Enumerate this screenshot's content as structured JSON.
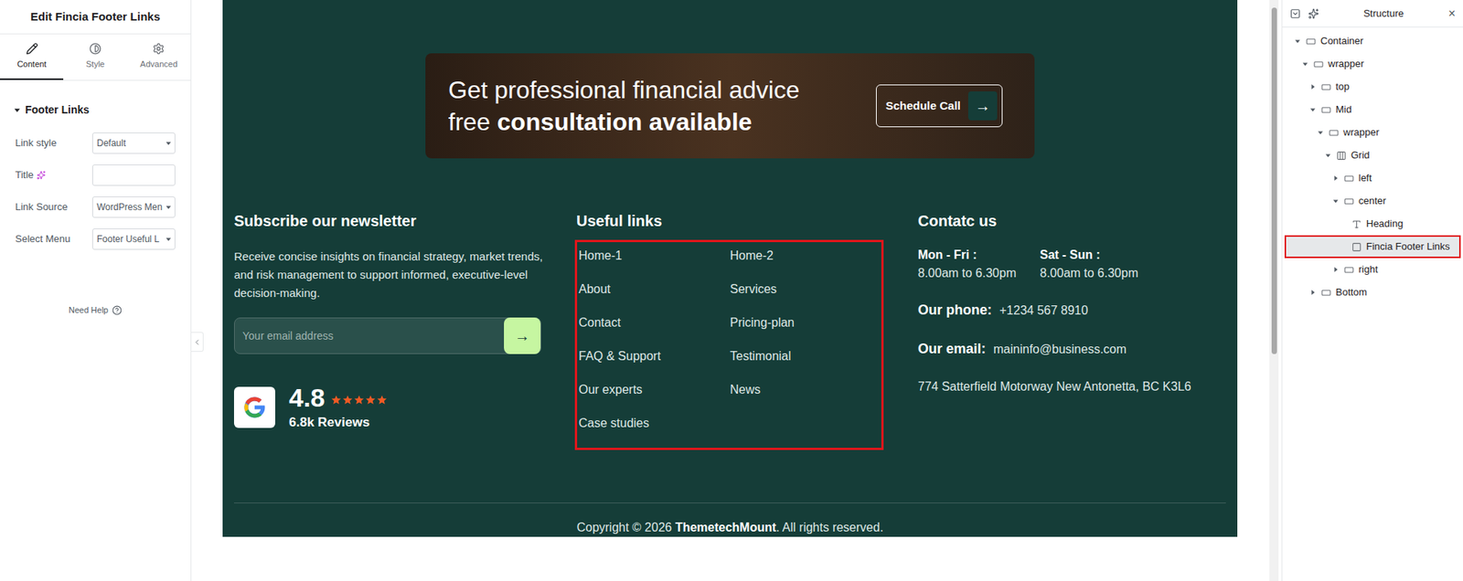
{
  "editor_panel": {
    "title": "Edit Fincia Footer Links",
    "tabs": [
      {
        "label": "Content",
        "icon": "pencil",
        "selected": true
      },
      {
        "label": "Style",
        "icon": "contrast",
        "selected": false
      },
      {
        "label": "Advanced",
        "icon": "gear",
        "selected": false
      }
    ],
    "section": {
      "title": "Footer Links",
      "expanded": true
    },
    "controls": [
      {
        "label": "Link style",
        "kind": "select",
        "value": "Default",
        "ai": false
      },
      {
        "label": "Title",
        "kind": "text",
        "value": "",
        "ai": true
      },
      {
        "label": "Link Source",
        "kind": "select",
        "value": "WordPress Men",
        "ai": false
      },
      {
        "label": "Select Menu",
        "kind": "select",
        "value": "Footer Useful L",
        "ai": false
      }
    ],
    "help": "Need Help"
  },
  "cta": {
    "line1": "Get professional financial advice",
    "line2_regular": "free ",
    "line2_bold": "consultation available",
    "button": "Schedule Call",
    "button_icon": "→"
  },
  "newsletter": {
    "heading": "Subscribe our newsletter",
    "text": "Receive concise insights on financial strategy, market trends, and risk management to support informed, executive-level decision-making.",
    "placeholder": "Your email address",
    "submit_icon": "→"
  },
  "rating": {
    "score": "4.8",
    "stars": 5,
    "reviews": "6.8k Reviews"
  },
  "useful_links": {
    "heading": "Useful links",
    "selected": true,
    "links": [
      "Home-1",
      "Home-2",
      "About",
      "Services",
      "Contact",
      "Pricing-plan",
      "FAQ & Support",
      "Testimonial",
      "Our experts",
      "News",
      "Case studies"
    ]
  },
  "contact": {
    "heading": "Contatc us",
    "hours": [
      {
        "day": "Mon - Fri :",
        "time": "8.00am to 6.30pm"
      },
      {
        "day": "Sat - Sun :",
        "time": "8.00am to 6.30pm"
      }
    ],
    "phone_label": "Our phone:",
    "phone": "+1234 567 8910",
    "email_label": "Our email:",
    "email": "maininfo@business.com",
    "address": "774 Satterfield Motorway New Antonetta, BC K3L6"
  },
  "copyright": {
    "prefix": "Copyright © 2026 ",
    "brand": "ThemetechMount",
    "suffix": ". All rights reserved."
  },
  "structure": {
    "title": "Structure",
    "close": "×",
    "items": [
      {
        "label": "Container",
        "depth": 0,
        "kind": "container",
        "expandable": true,
        "expanded": true,
        "selected": false
      },
      {
        "label": "wrapper",
        "depth": 1,
        "kind": "container",
        "expandable": true,
        "expanded": true,
        "selected": false
      },
      {
        "label": "top",
        "depth": 2,
        "kind": "container",
        "expandable": true,
        "expanded": false,
        "selected": false
      },
      {
        "label": "Mid",
        "depth": 2,
        "kind": "container",
        "expandable": true,
        "expanded": true,
        "selected": false
      },
      {
        "label": "wrapper",
        "depth": 3,
        "kind": "container",
        "expandable": true,
        "expanded": true,
        "selected": false
      },
      {
        "label": "Grid",
        "depth": 4,
        "kind": "grid",
        "expandable": true,
        "expanded": true,
        "selected": false
      },
      {
        "label": "left",
        "depth": 5,
        "kind": "container",
        "expandable": true,
        "expanded": false,
        "selected": false
      },
      {
        "label": "center",
        "depth": 5,
        "kind": "container",
        "expandable": true,
        "expanded": true,
        "selected": false
      },
      {
        "label": "Heading",
        "depth": 6,
        "kind": "heading",
        "expandable": false,
        "expanded": false,
        "selected": false
      },
      {
        "label": "Fincia Footer Links",
        "depth": 6,
        "kind": "widget",
        "expandable": false,
        "expanded": false,
        "selected": true
      },
      {
        "label": "right",
        "depth": 5,
        "kind": "container",
        "expandable": true,
        "expanded": false,
        "selected": false
      },
      {
        "label": "Bottom",
        "depth": 2,
        "kind": "container",
        "expandable": true,
        "expanded": false,
        "selected": false
      }
    ]
  }
}
